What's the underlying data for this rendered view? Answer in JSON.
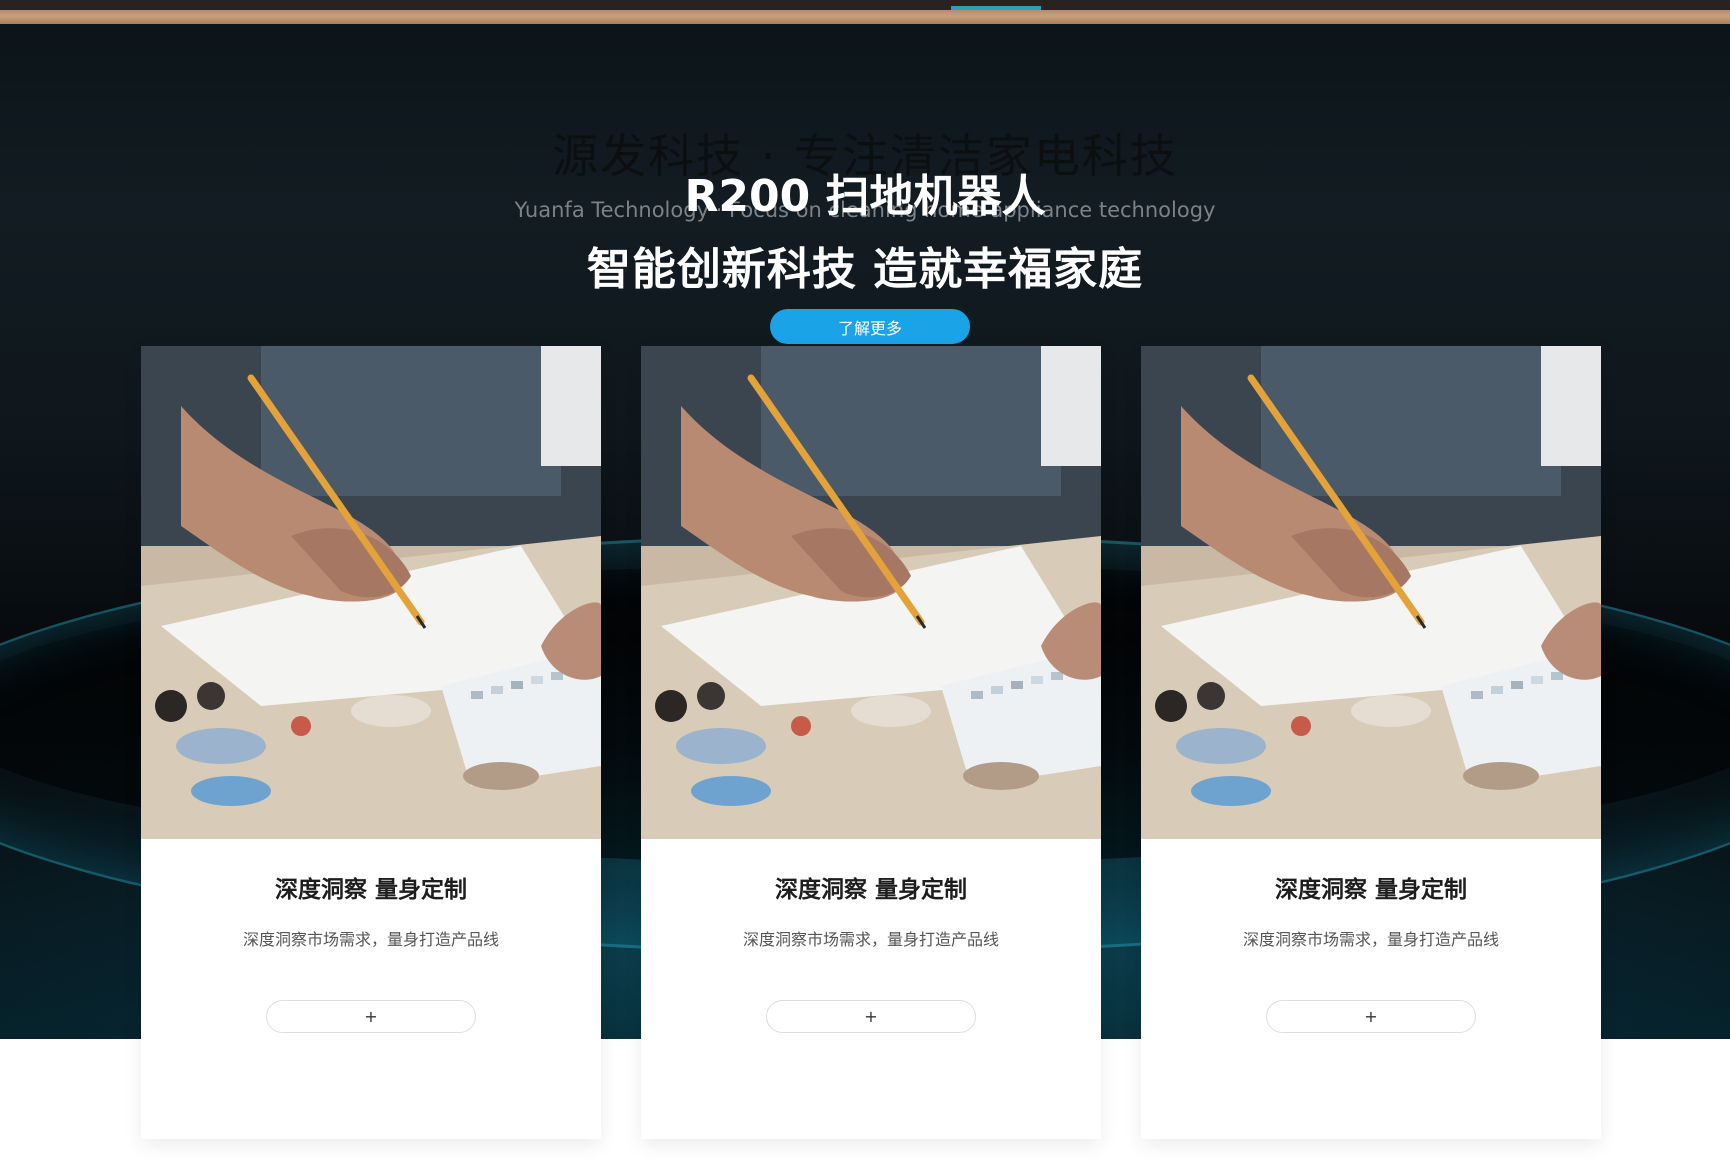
{
  "hero": {
    "bg_title": "源发科技 · 专注清洁家电科技",
    "bg_subtitle": "Yuanfa Technology · Focus on cleaning home appliance technology",
    "title": "R200 扫地机器人",
    "slogan": "智能创新科技 造就幸福家庭",
    "button_label": "了解更多"
  },
  "cards": [
    {
      "title": "深度洞察 量身定制",
      "description": "深度洞察市场需求，量身打造产品线",
      "button_label": "+"
    },
    {
      "title": "深度洞察 量身定制",
      "description": "深度洞察市场需求，量身打造产品线",
      "button_label": "+"
    },
    {
      "title": "深度洞察 量身定制",
      "description": "深度洞察市场需求，量身打造产品线",
      "button_label": "+"
    }
  ],
  "colors": {
    "accent_blue": "#1aa3e6",
    "hero_dark": "#0b1419",
    "teal_glow": "#1a8aa6"
  }
}
